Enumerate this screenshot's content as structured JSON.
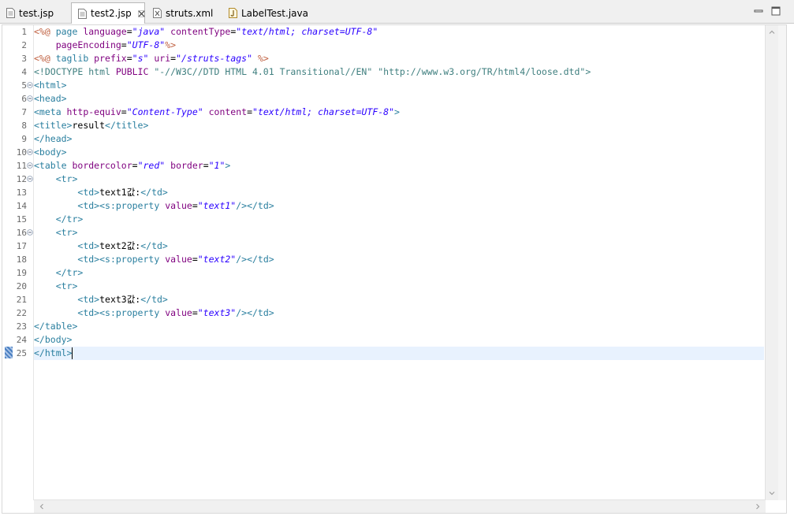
{
  "tabs": [
    {
      "label": "test.jsp",
      "icon": "jsp-file-icon",
      "active": false
    },
    {
      "label": "test2.jsp",
      "icon": "jsp-file-icon",
      "active": true
    },
    {
      "label": "struts.xml",
      "icon": "xml-file-icon",
      "active": false
    },
    {
      "label": "LabelTest.java",
      "icon": "java-file-icon",
      "active": false
    }
  ],
  "window_controls": [
    "minimize-icon",
    "maximize-icon"
  ],
  "colors": {
    "tag": "#2a7f9f",
    "attr": "#7f007f",
    "value": "#2a00ff",
    "directive": "#bf5f3f",
    "doctype": "#3f7f7f",
    "text": "#000000",
    "current_line": "#e8f2fe"
  },
  "editor": {
    "current_line": 25,
    "fold_lines": [
      5,
      6,
      10,
      11,
      12,
      16
    ],
    "lines": [
      {
        "n": "1",
        "segs": [
          [
            "<%@ ",
            "directive"
          ],
          [
            "page ",
            "tag"
          ],
          [
            "language",
            "attr"
          ],
          [
            "=",
            "text"
          ],
          [
            "\"java\"",
            "value"
          ],
          [
            " ",
            "text"
          ],
          [
            "contentType",
            "attr"
          ],
          [
            "=",
            "text"
          ],
          [
            "\"text/html; charset=UTF-8\"",
            "value"
          ]
        ]
      },
      {
        "n": "2",
        "segs": [
          [
            "    ",
            "text"
          ],
          [
            "pageEncoding",
            "attr"
          ],
          [
            "=",
            "text"
          ],
          [
            "\"UTF-8\"",
            "value"
          ],
          [
            "%>",
            "directive"
          ]
        ]
      },
      {
        "n": "3",
        "segs": [
          [
            "<%@ ",
            "directive"
          ],
          [
            "taglib ",
            "tag"
          ],
          [
            "prefix",
            "attr"
          ],
          [
            "=",
            "text"
          ],
          [
            "\"s\"",
            "value"
          ],
          [
            " ",
            "text"
          ],
          [
            "uri",
            "attr"
          ],
          [
            "=",
            "text"
          ],
          [
            "\"/struts-tags\"",
            "value"
          ],
          [
            " %>",
            "directive"
          ]
        ]
      },
      {
        "n": "4",
        "segs": [
          [
            "<!DOCTYPE html ",
            "doctype"
          ],
          [
            "PUBLIC ",
            "attr"
          ],
          [
            "\"-//W3C//DTD HTML 4.01 Transitional//EN\"",
            "doctype"
          ],
          [
            " ",
            "text"
          ],
          [
            "\"http://www.w3.org/TR/html4/loose.dtd\"",
            "doctype"
          ],
          [
            ">",
            "doctype"
          ]
        ]
      },
      {
        "n": "5",
        "segs": [
          [
            "<html>",
            "tag"
          ]
        ]
      },
      {
        "n": "6",
        "segs": [
          [
            "<head>",
            "tag"
          ]
        ]
      },
      {
        "n": "7",
        "segs": [
          [
            "<meta ",
            "tag"
          ],
          [
            "http-equiv",
            "attr"
          ],
          [
            "=",
            "text"
          ],
          [
            "\"Content-Type\"",
            "value"
          ],
          [
            " ",
            "text"
          ],
          [
            "content",
            "attr"
          ],
          [
            "=",
            "text"
          ],
          [
            "\"text/html; charset=UTF-8\"",
            "value"
          ],
          [
            ">",
            "tag"
          ]
        ]
      },
      {
        "n": "8",
        "segs": [
          [
            "<title>",
            "tag"
          ],
          [
            "result",
            "text"
          ],
          [
            "</title>",
            "tag"
          ]
        ]
      },
      {
        "n": "9",
        "segs": [
          [
            "</head>",
            "tag"
          ]
        ]
      },
      {
        "n": "10",
        "segs": [
          [
            "<body>",
            "tag"
          ]
        ]
      },
      {
        "n": "11",
        "segs": [
          [
            "<table ",
            "tag"
          ],
          [
            "bordercolor",
            "attr"
          ],
          [
            "=",
            "text"
          ],
          [
            "\"red\"",
            "value"
          ],
          [
            " ",
            "text"
          ],
          [
            "border",
            "attr"
          ],
          [
            "=",
            "text"
          ],
          [
            "\"1\"",
            "value"
          ],
          [
            ">",
            "tag"
          ]
        ]
      },
      {
        "n": "12",
        "segs": [
          [
            "    ",
            "text"
          ],
          [
            "<tr>",
            "tag"
          ]
        ]
      },
      {
        "n": "13",
        "segs": [
          [
            "        ",
            "text"
          ],
          [
            "<td>",
            "tag"
          ],
          [
            "text1값:",
            "text"
          ],
          [
            "</td>",
            "tag"
          ]
        ]
      },
      {
        "n": "14",
        "segs": [
          [
            "        ",
            "text"
          ],
          [
            "<td>",
            "tag"
          ],
          [
            "<s:property ",
            "tag"
          ],
          [
            "value",
            "attr"
          ],
          [
            "=",
            "text"
          ],
          [
            "\"text1\"",
            "value"
          ],
          [
            "/>",
            "tag"
          ],
          [
            "</td>",
            "tag"
          ]
        ]
      },
      {
        "n": "15",
        "segs": [
          [
            "    ",
            "text"
          ],
          [
            "</tr>",
            "tag"
          ]
        ]
      },
      {
        "n": "16",
        "segs": [
          [
            "    ",
            "text"
          ],
          [
            "<tr>",
            "tag"
          ]
        ]
      },
      {
        "n": "17",
        "segs": [
          [
            "        ",
            "text"
          ],
          [
            "<td>",
            "tag"
          ],
          [
            "text2값:",
            "text"
          ],
          [
            "</td>",
            "tag"
          ]
        ]
      },
      {
        "n": "18",
        "segs": [
          [
            "        ",
            "text"
          ],
          [
            "<td>",
            "tag"
          ],
          [
            "<s:property ",
            "tag"
          ],
          [
            "value",
            "attr"
          ],
          [
            "=",
            "text"
          ],
          [
            "\"text2\"",
            "value"
          ],
          [
            "/>",
            "tag"
          ],
          [
            "</td>",
            "tag"
          ]
        ]
      },
      {
        "n": "19",
        "segs": [
          [
            "    ",
            "text"
          ],
          [
            "</tr>",
            "tag"
          ]
        ]
      },
      {
        "n": "20",
        "segs": [
          [
            "    ",
            "text"
          ],
          [
            "<tr>",
            "tag"
          ]
        ]
      },
      {
        "n": "21",
        "segs": [
          [
            "        ",
            "text"
          ],
          [
            "<td>",
            "tag"
          ],
          [
            "text3값:",
            "text"
          ],
          [
            "</td>",
            "tag"
          ]
        ]
      },
      {
        "n": "22",
        "segs": [
          [
            "        ",
            "text"
          ],
          [
            "<td>",
            "tag"
          ],
          [
            "<s:property ",
            "tag"
          ],
          [
            "value",
            "attr"
          ],
          [
            "=",
            "text"
          ],
          [
            "\"text3\"",
            "value"
          ],
          [
            "/>",
            "tag"
          ],
          [
            "</td>",
            "tag"
          ]
        ]
      },
      {
        "n": "23",
        "segs": [
          [
            "</table>",
            "tag"
          ]
        ]
      },
      {
        "n": "24",
        "segs": [
          [
            "</body>",
            "tag"
          ]
        ]
      },
      {
        "n": "25",
        "segs": [
          [
            "</html>",
            "tag"
          ]
        ]
      }
    ]
  }
}
